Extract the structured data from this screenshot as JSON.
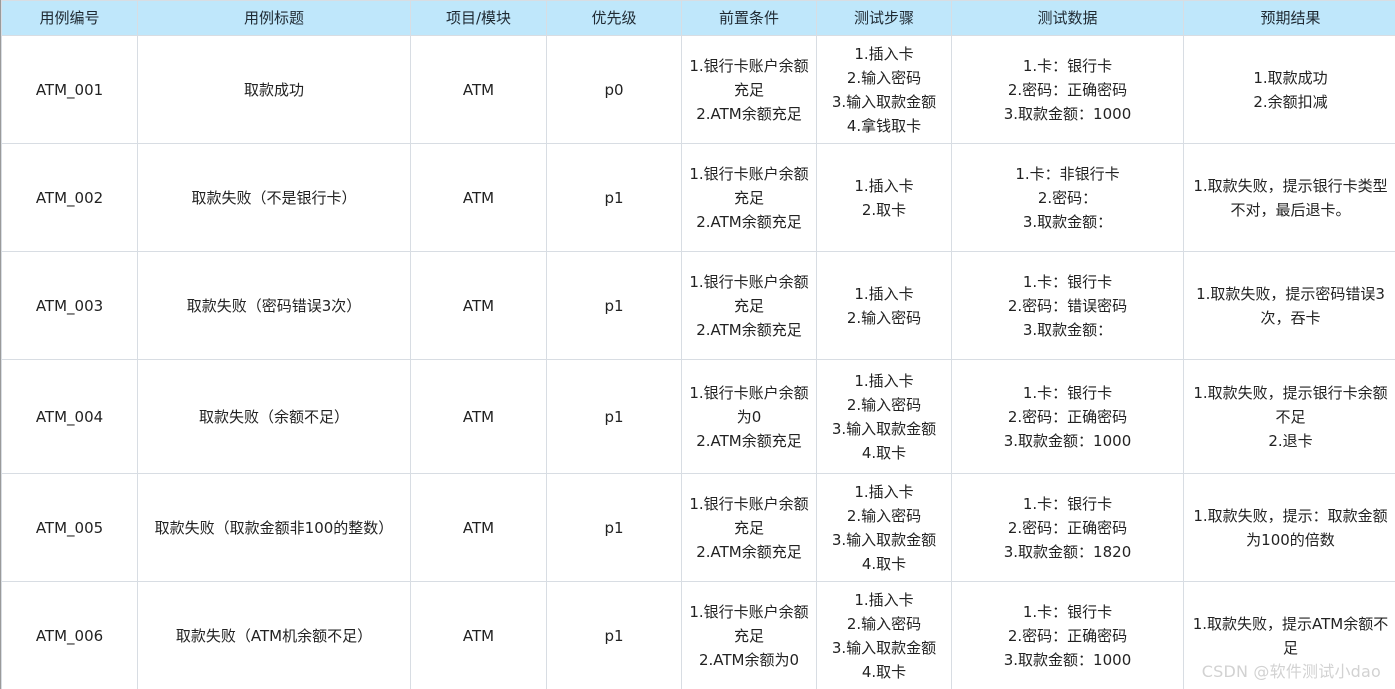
{
  "headers": [
    "用例编号",
    "用例标题",
    "项目/模块",
    "优先级",
    "前置条件",
    "测试步骤",
    "测试数据",
    "预期结果"
  ],
  "rows": [
    {
      "id": "ATM_001",
      "title": "取款成功",
      "module": "ATM",
      "priority": "p0",
      "precondition": [
        "1.银行卡账户余额充足",
        "2.ATM余额充足"
      ],
      "steps": [
        "1.插入卡",
        "2.输入密码",
        "3.输入取款金额",
        "4.拿钱取卡"
      ],
      "data": [
        "1.卡：银行卡",
        "2.密码：正确密码",
        "3.取款金额：1000"
      ],
      "expected": [
        "1.取款成功",
        "2.余额扣减"
      ]
    },
    {
      "id": "ATM_002",
      "title": "取款失败（不是银行卡）",
      "module": "ATM",
      "priority": "p1",
      "precondition": [
        "1.银行卡账户余额充足",
        "2.ATM余额充足"
      ],
      "steps": [
        "1.插入卡",
        "2.取卡"
      ],
      "data": [
        "1.卡：非银行卡",
        "2.密码：",
        "3.取款金额："
      ],
      "expected": [
        "1.取款失败，提示银行卡类型不对，最后退卡。"
      ]
    },
    {
      "id": "ATM_003",
      "title": "取款失败（密码错误3次）",
      "module": "ATM",
      "priority": "p1",
      "precondition": [
        "1.银行卡账户余额充足",
        "2.ATM余额充足"
      ],
      "steps": [
        "1.插入卡",
        "2.输入密码"
      ],
      "data": [
        "1.卡：银行卡",
        "2.密码：错误密码",
        "3.取款金额："
      ],
      "expected": [
        "1.取款失败，提示密码错误3次，吞卡"
      ]
    },
    {
      "id": "ATM_004",
      "title": "取款失败（余额不足）",
      "module": "ATM",
      "priority": "p1",
      "precondition": [
        "1.银行卡账户余额为0",
        "2.ATM余额充足"
      ],
      "steps": [
        "1.插入卡",
        "2.输入密码",
        "3.输入取款金额",
        "4.取卡"
      ],
      "data": [
        "1.卡：银行卡",
        "2.密码：正确密码",
        "3.取款金额：1000"
      ],
      "expected": [
        "1.取款失败，提示银行卡余额不足",
        "2.退卡"
      ]
    },
    {
      "id": "ATM_005",
      "title": "取款失败（取款金额非100的整数）",
      "module": "ATM",
      "priority": "p1",
      "precondition": [
        "1.银行卡账户余额充足",
        "2.ATM余额充足"
      ],
      "steps": [
        "1.插入卡",
        "2.输入密码",
        "3.输入取款金额",
        "4.取卡"
      ],
      "data": [
        "1.卡：银行卡",
        "2.密码：正确密码",
        "3.取款金额：1820"
      ],
      "expected": [
        "1.取款失败，提示：取款金额为100的倍数"
      ]
    },
    {
      "id": "ATM_006",
      "title": "取款失败（ATM机余额不足）",
      "module": "ATM",
      "priority": "p1",
      "precondition": [
        "1.银行卡账户余额充足",
        "2.ATM余额为0"
      ],
      "steps": [
        "1.插入卡",
        "2.输入密码",
        "3.输入取款金额",
        "4.取卡"
      ],
      "data": [
        "1.卡：银行卡",
        "2.密码：正确密码",
        "3.取款金额：1000"
      ],
      "expected": [
        "1.取款失败，提示ATM余额不足"
      ]
    }
  ],
  "watermark": "CSDN @软件测试小dao",
  "colors": {
    "header_bg": "#bfe7fb",
    "grid": "#d8dde3",
    "watermark": "#d2d2d2"
  }
}
